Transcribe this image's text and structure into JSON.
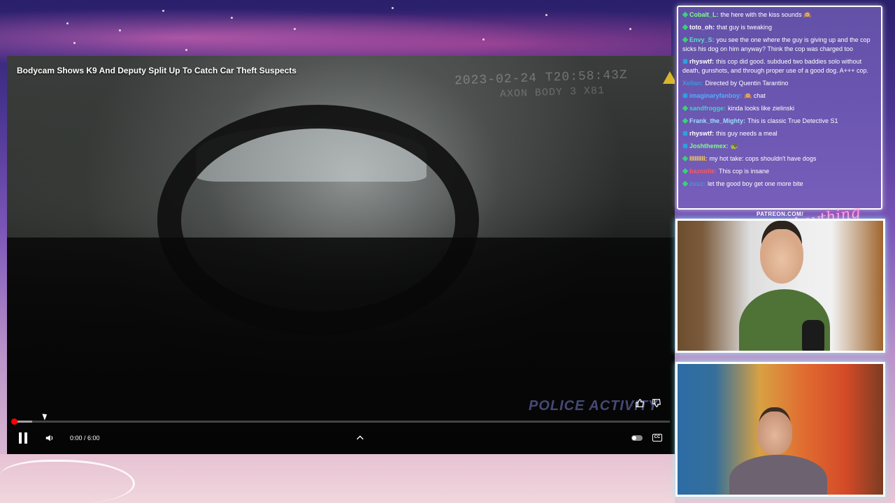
{
  "video": {
    "title": "Bodycam Shows K9 And Deputy Split Up To Catch Car Theft Suspects",
    "timestamp_overlay": "2023-02-24 T20:58:43Z",
    "timestamp_overlay_2": "AXON BODY 3 X81",
    "watermark": "POLICE ACTIVITY",
    "time_display": "0:00 / 6:00",
    "progress_fraction": 0.0,
    "buffered_fraction": 0.03
  },
  "controls": {
    "pause_icon": "pause-icon",
    "volume_icon": "volume-icon",
    "chevron_icon": "chevron-up-icon",
    "toggle_icon": "autoplay-toggle-icon",
    "cc_label": "CC",
    "like_icon": "thumbs-up-icon",
    "dislike_icon": "thumbs-down-icon"
  },
  "chat": {
    "messages": [
      {
        "badge": "green",
        "user": "Cobalt_L",
        "user_color": "#7dff8a",
        "text": "the here with the kiss sounds 🙉"
      },
      {
        "badge": "green",
        "user": "toto_oh",
        "user_color": "#ffffff",
        "text": "that guy is tweaking"
      },
      {
        "badge": "green",
        "user": "Envy_S",
        "user_color": "#5ee0c4",
        "text": "you see the one where the guy is giving up and the cop sicks his dog on him anyway? Think the cop was charged too"
      },
      {
        "badge": "blue",
        "user": "rhyswtf",
        "user_color": "#ffffff",
        "text": "this cop did good. subdued two baddies solo without death, gunshots, and through proper use of a good dog. A+++ cop."
      },
      {
        "badge": "",
        "user": "Xelian",
        "user_color": "#3a9bd8",
        "text": "Directed by Quentin Tarantino"
      },
      {
        "badge": "blue",
        "user": "imaginaryfanboy",
        "user_color": "#4fb0ff",
        "text": "🙉 chat"
      },
      {
        "badge": "green",
        "user": "sandfrogge",
        "user_color": "#3ad8c0",
        "text": "kinda looks like zielinski"
      },
      {
        "badge": "green",
        "user": "Frank_the_Mighty",
        "user_color": "#9ee0ff",
        "text": "This is classic True Detective S1"
      },
      {
        "badge": "blue",
        "user": "rhyswtf",
        "user_color": "#ffffff",
        "text": "this guy needs a meal"
      },
      {
        "badge": "blue",
        "user": "Joshthemex",
        "user_color": "#7dff8a",
        "text": "🐢"
      },
      {
        "badge": "green",
        "user": "IIIIIIIII",
        "user_color": "#ffd84a",
        "text": "my hot take: cops shouldn't have dogs"
      },
      {
        "badge": "green",
        "user": "bazoolie",
        "user_color": "#ff5a5a",
        "text": "This cop is insane"
      },
      {
        "badge": "green",
        "user": "zuuz",
        "user_color": "#3a9bd8",
        "text": "let the good boy get one more bite"
      }
    ]
  },
  "branding": {
    "patreon": "PATREON.COM/",
    "signature": "Anything Else?"
  }
}
